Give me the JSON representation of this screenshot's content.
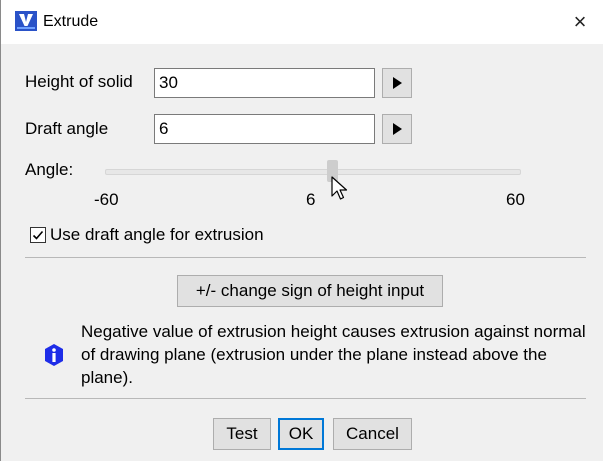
{
  "window": {
    "title": "Extrude",
    "close_symbol": "×"
  },
  "height": {
    "label": "Height of solid",
    "value": "30"
  },
  "draft": {
    "label": "Draft angle",
    "value": "6"
  },
  "slider": {
    "label": "Angle:",
    "min_label": "-60",
    "current_label": "6",
    "max_label": "60",
    "min": -60,
    "max": 60,
    "value": 6
  },
  "checkbox": {
    "label": "Use draft angle for extrusion",
    "checked": true
  },
  "sign_button": {
    "label": "+/- change sign of height input"
  },
  "info": {
    "text": "Negative value of extrusion height causes extrusion against normal of drawing plane (extrusion under the plane instead above the plane)."
  },
  "buttons": {
    "test": "Test",
    "ok": "OK",
    "cancel": "Cancel"
  },
  "colors": {
    "accent": "#0078d7",
    "info_icon": "#1e2de8",
    "app_icon": "#2a52c8"
  }
}
